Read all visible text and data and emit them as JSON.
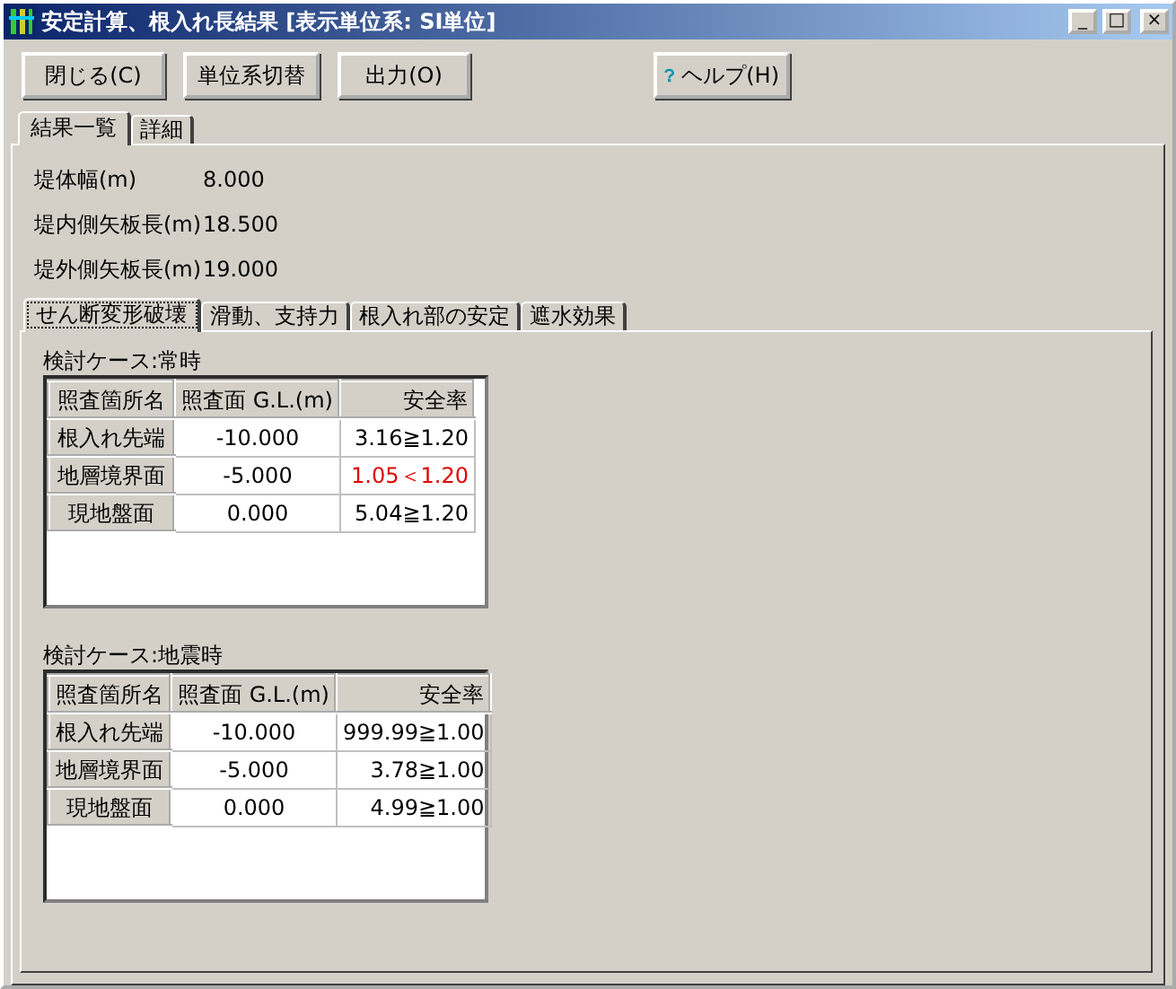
{
  "window": {
    "title": "安定計算、根入れ長結果 [表示単位系: SI単位]",
    "controls": [
      "_",
      "□",
      "×"
    ]
  },
  "toolbar": [
    {
      "label": "閉じる(C)",
      "kind": "plain"
    },
    {
      "label": "単位系切替",
      "kind": "plain"
    },
    {
      "label": "出力(O)",
      "kind": "plain"
    },
    {
      "label": "ヘルプ(H)",
      "kind": "help"
    }
  ],
  "tabs": [
    {
      "label": "結果一覧",
      "selected": true
    },
    {
      "label": "詳細",
      "selected": false
    }
  ],
  "summary": [
    {
      "label": "堤体幅(m)",
      "value": "8.000"
    },
    {
      "label": "堤内側矢板長(m)",
      "value": "18.500"
    },
    {
      "label": "堤外側矢板長(m)",
      "value": "19.000"
    }
  ],
  "subtabs": [
    {
      "label": "せん断変形破壊",
      "selected": true
    },
    {
      "label": "滑動、支持力",
      "selected": false
    },
    {
      "label": "根入れ部の安定",
      "selected": false
    },
    {
      "label": "遮水効果",
      "selected": false
    }
  ],
  "cases": [
    {
      "title": "検討ケース:常時",
      "columns": [
        "照査箇所名",
        "照査面 G.L.(m)",
        "安全率"
      ],
      "rows": [
        {
          "name": "根入れ先端",
          "gl": "-10.000",
          "factor": "3.16≧1.20",
          "fails": false
        },
        {
          "name": "地層境界面",
          "gl": "-5.000",
          "factor": "1.05＜1.20",
          "fails": true
        },
        {
          "name": "現地盤面",
          "gl": "0.000",
          "factor": "5.04≧1.20",
          "fails": false
        }
      ]
    },
    {
      "title": "検討ケース:地震時",
      "columns": [
        "照査箇所名",
        "照査面 G.L.(m)",
        "安全率"
      ],
      "rows": [
        {
          "name": "根入れ先端",
          "gl": "-10.000",
          "factor": "999.99≧1.00",
          "fails": false
        },
        {
          "name": "地層境界面",
          "gl": "-5.000",
          "factor": "3.78≧1.00",
          "fails": false
        },
        {
          "name": "現地盤面",
          "gl": "0.000",
          "factor": "4.99≧1.00",
          "fails": false
        }
      ]
    }
  ]
}
